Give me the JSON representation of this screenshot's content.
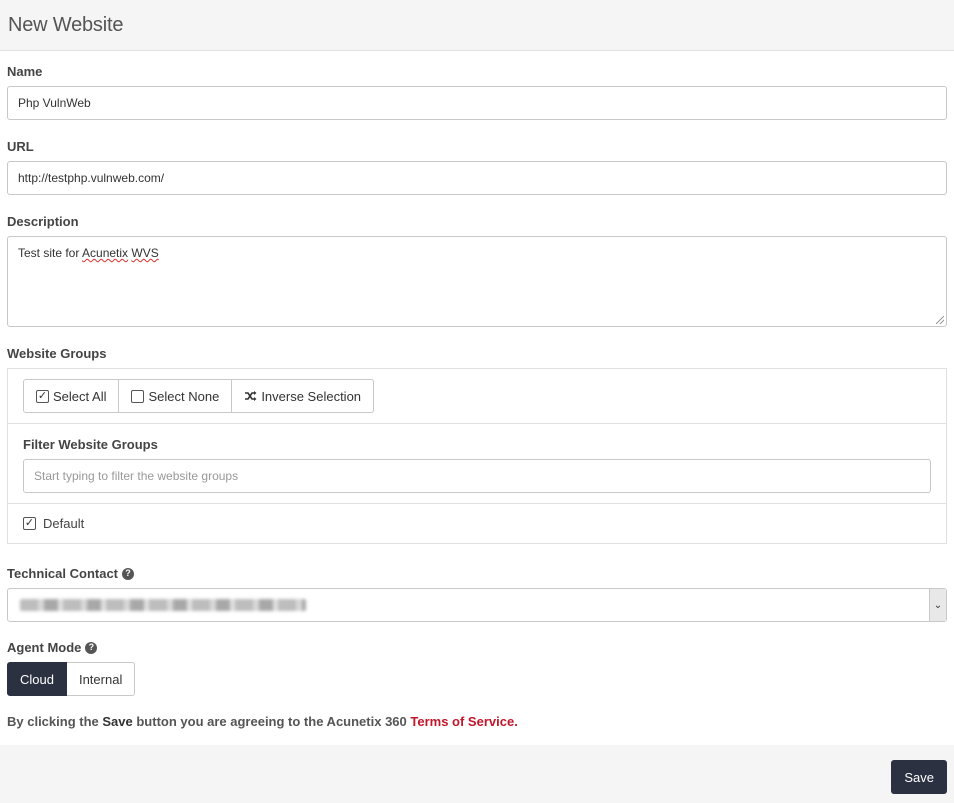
{
  "header": {
    "title": "New Website"
  },
  "form": {
    "name": {
      "label": "Name",
      "value": "Php VulnWeb"
    },
    "url": {
      "label": "URL",
      "value": "http://testphp.vulnweb.com/"
    },
    "description": {
      "label": "Description",
      "value_plain": "Test site for ",
      "value_word1": "Acunetix",
      "value_space": " ",
      "value_word2": "WVS"
    },
    "website_groups": {
      "label": "Website Groups",
      "select_all": "Select All",
      "select_none": "Select None",
      "inverse": "Inverse Selection",
      "filter_label": "Filter Website Groups",
      "filter_placeholder": "Start typing to filter the website groups",
      "groups": [
        {
          "label": "Default",
          "checked": true
        }
      ]
    },
    "technical_contact": {
      "label": "Technical Contact",
      "value_redacted": true
    },
    "agent_mode": {
      "label": "Agent Mode",
      "options": [
        "Cloud",
        "Internal"
      ],
      "selected": "Cloud"
    },
    "terms": {
      "prefix": "By clicking the ",
      "save_word": "Save",
      "middle": " button you are agreeing to the Acunetix 360 ",
      "link": "Terms of Service",
      "suffix": "."
    }
  },
  "footer": {
    "save_label": "Save"
  },
  "colors": {
    "primary": "#2b3140",
    "link": "#c0172b",
    "panel_bg": "#f5f5f5"
  }
}
